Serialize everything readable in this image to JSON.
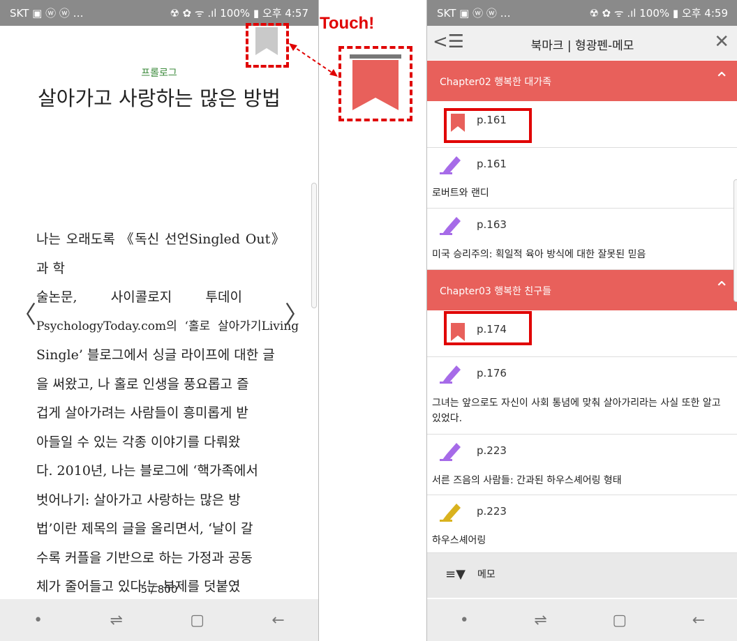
{
  "left": {
    "status": {
      "carrier": "SKT",
      "icons": "▣ ⓦ ⓦ …",
      "right_icons": "☢ ✿ ᯤ .ıl",
      "battery": "100%",
      "time": "오후 4:57"
    },
    "chapter_label": "프롤로그",
    "title": "살아가고 사랑하는 많은 방법",
    "body_lines": [
      "나는 오래도록 《독신 선언Singled Out》과 학",
      "술논문,        사이콜로지        투데이",
      "PsychologyToday.com의  ‘홀로  살아가기Living",
      "Single’ 블로그에서 싱글 라이프에 대한 글",
      "을 써왔고, 나 홀로 인생을 풍요롭고 즐",
      "겁게 살아가려는 사람들이 흥미롭게 받",
      "아들일 수 있는 각종 이야기를 다뤄왔",
      "다. 2010년, 나는 블로그에 ‘핵가족에서",
      "벗어나기: 살아가고 사랑하는 많은 방",
      "법’이란 제목의 글을 올리면서, ‘날이 갈",
      "수록 커플을 기반으로 하는 가정과 공동",
      "체가 줄어들고 있다’는 부제를 덧붙였"
    ],
    "prev_chevron": "〈",
    "next_chevron": "〉",
    "page_indicator": "5 / 800",
    "nav": {
      "dot": "•",
      "recents": "⇌",
      "home": "▢",
      "back": "←"
    }
  },
  "callout": {
    "touch_label": "Touch!"
  },
  "right": {
    "status": {
      "carrier": "SKT",
      "icons": "▣ ⓦ ⓦ …",
      "right_icons": "☢ ✿ ᯤ .ıl",
      "battery": "100%",
      "time": "오후 4:59"
    },
    "header": {
      "back": "<☰",
      "title": "북마크 | 형광펜-메모",
      "close": "✕"
    },
    "chapters": [
      {
        "label": "Chapter02 행복한 대가족",
        "caret": "⌃"
      },
      {
        "label": "Chapter03 행복한 친구들",
        "caret": "⌃"
      }
    ],
    "items": [
      {
        "type": "bookmark",
        "page": "p.161",
        "note": ""
      },
      {
        "type": "highlight-purple",
        "page": "p.161",
        "note": "로버트와 랜디"
      },
      {
        "type": "highlight-purple",
        "page": "p.163",
        "note": "미국 승리주의: 획일적 육아 방식에 대한 잘못된 믿음"
      },
      {
        "type": "bookmark",
        "page": "p.174",
        "note": ""
      },
      {
        "type": "highlight-purple",
        "page": "p.176",
        "note": "그녀는 앞으로도 자신이 사회 통념에 맞춰 살아가리라는 사실 또한 알고 있었다."
      },
      {
        "type": "highlight-purple",
        "page": "p.223",
        "note": "서른 즈음의 사람들: 간과된 하우스셰어링 형태"
      },
      {
        "type": "highlight-yellow",
        "page": "p.223",
        "note": "하우스셰어링"
      }
    ],
    "memo": {
      "label": "메모"
    },
    "nav": {
      "dot": "•",
      "recents": "⇌",
      "home": "▢",
      "back": "←"
    }
  },
  "colors": {
    "accent_red": "#e8605b",
    "highlight_purple": "#a66be8",
    "highlight_yellow": "#d9b21e",
    "callout_red": "#e00000"
  }
}
